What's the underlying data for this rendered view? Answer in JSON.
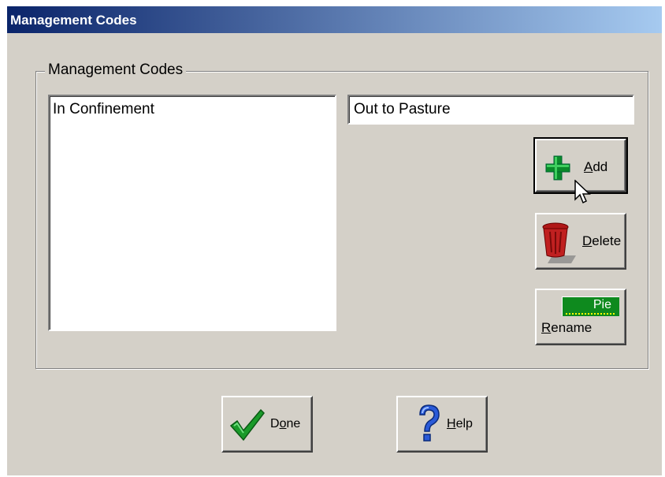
{
  "window": {
    "title": "Management Codes"
  },
  "group": {
    "label": "Management Codes"
  },
  "list": {
    "items": [
      "In Confinement"
    ]
  },
  "input": {
    "value": "Out to Pasture"
  },
  "buttons": {
    "add": {
      "pre": "",
      "accel": "A",
      "post": "dd"
    },
    "delete": {
      "pre": "",
      "accel": "D",
      "post": "elete"
    },
    "rename": {
      "pre": "",
      "accel": "R",
      "post": "ename",
      "icon_text": "Pie"
    },
    "done": {
      "pre": "D",
      "accel": "o",
      "post": "ne"
    },
    "help": {
      "pre": "",
      "accel": "H",
      "post": "elp"
    }
  },
  "icons": {
    "add": "plus-icon",
    "delete": "trash-can-icon",
    "rename": "rename-tag-icon",
    "done": "checkmark-icon",
    "help": "question-mark-icon",
    "cursor": "mouse-pointer-icon"
  },
  "colors": {
    "titlebar_start": "#0a246a",
    "titlebar_end": "#a6caf0",
    "face": "#d4d0c8"
  }
}
